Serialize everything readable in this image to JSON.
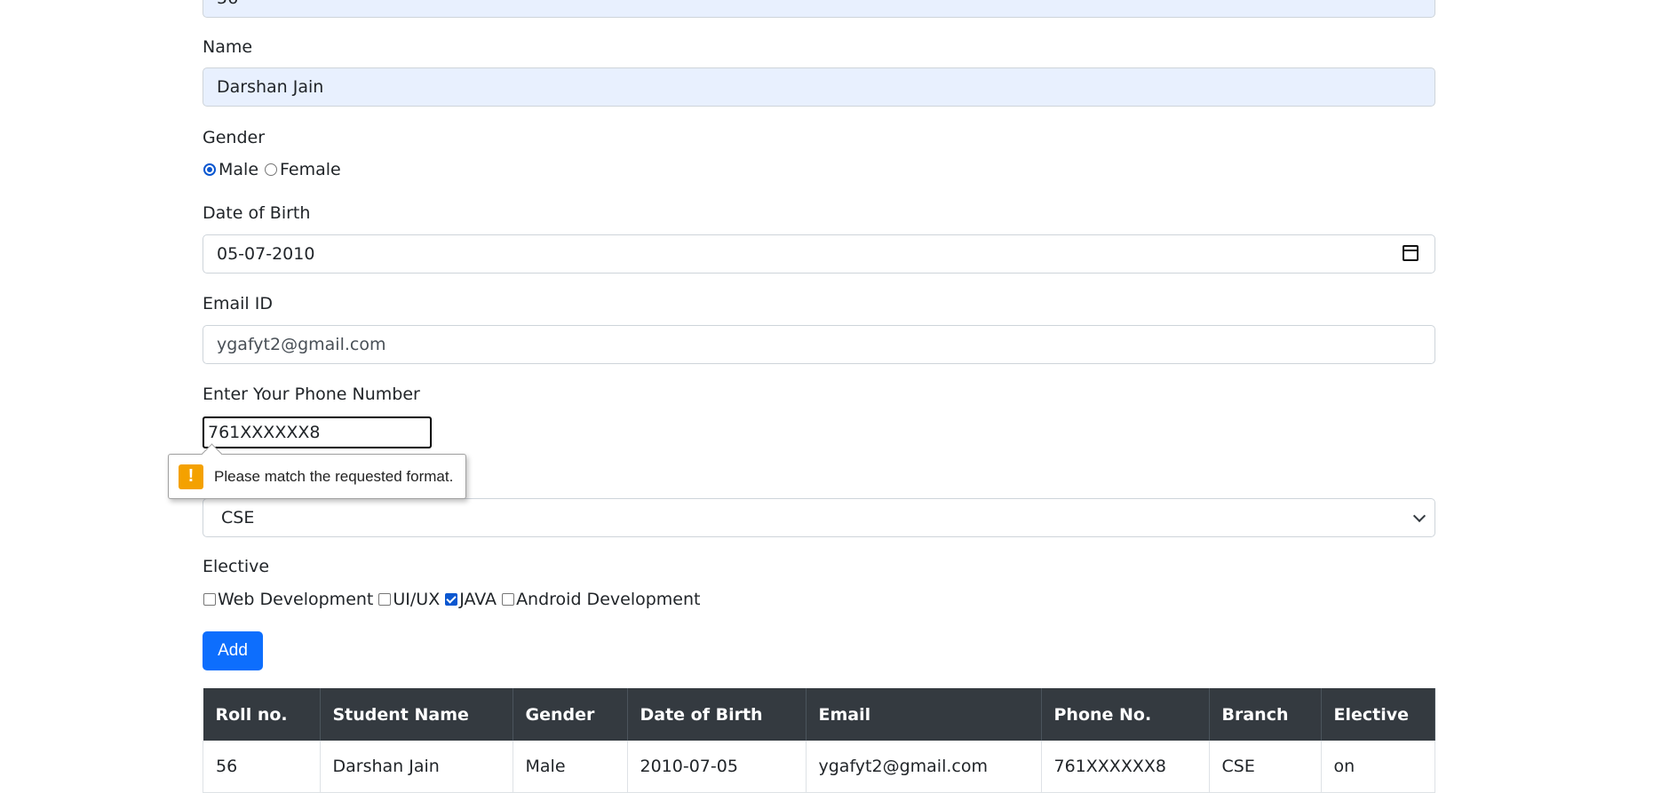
{
  "form": {
    "roll_value": "56",
    "name_label": "Name",
    "name_value": "Darshan Jain",
    "gender_label": "Gender",
    "gender_options": [
      "Male",
      "Female"
    ],
    "gender_selected": "Male",
    "dob_label": "Date of Birth",
    "dob_value": "05-07-2010",
    "email_label": "Email ID",
    "email_value": "ygafyt2@gmail.com",
    "phone_label": "Enter Your Phone Number",
    "phone_value": "761XXXXXX8",
    "validation_message": "Please match the requested format.",
    "branch_value": "CSE",
    "elective_label": "Elective",
    "electives": [
      {
        "label": "Web Development",
        "checked": false
      },
      {
        "label": "UI/UX",
        "checked": false
      },
      {
        "label": "JAVA",
        "checked": true
      },
      {
        "label": "Android Development",
        "checked": false
      }
    ],
    "add_label": "Add"
  },
  "table": {
    "headers": [
      "Roll no.",
      "Student Name",
      "Gender",
      "Date of Birth",
      "Email",
      "Phone No.",
      "Branch",
      "Elective"
    ],
    "rows": [
      [
        "56",
        "Darshan Jain",
        "Male",
        "2010-07-05",
        "ygafyt2@gmail.com",
        "761XXXXXX8",
        "CSE",
        "on"
      ]
    ]
  },
  "colors": {
    "primary": "#0d6efd",
    "table_header": "#343a40",
    "autofill": "#e8f0fe",
    "warning": "#f4a100"
  }
}
